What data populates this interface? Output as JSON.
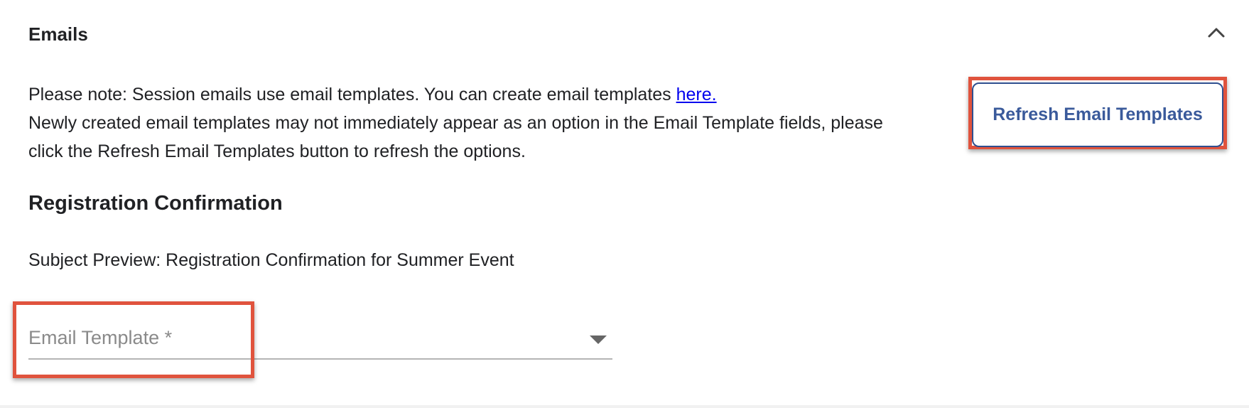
{
  "section": {
    "title": "Emails",
    "toggle_icon": "chevron-up-icon"
  },
  "note": {
    "line1_text": "Please note: Session emails use email templates. You can create email templates ",
    "line1_link": "here.",
    "line2": "Newly created email templates may not immediately appear as an option in the Email Template fields, please",
    "line3": "click the Refresh Email Templates button to refresh the options."
  },
  "refresh_button": {
    "label": "Refresh Email Templates"
  },
  "registration": {
    "title": "Registration Confirmation",
    "subject_preview": "Subject Preview: Registration Confirmation for Summer Event",
    "template_field": {
      "placeholder": "Email Template *",
      "value": "",
      "dropdown_icon": "caret-down-icon"
    }
  },
  "colors": {
    "highlight": "#e0533d",
    "button_text": "#3a5a9b",
    "link": "#0000ee"
  }
}
